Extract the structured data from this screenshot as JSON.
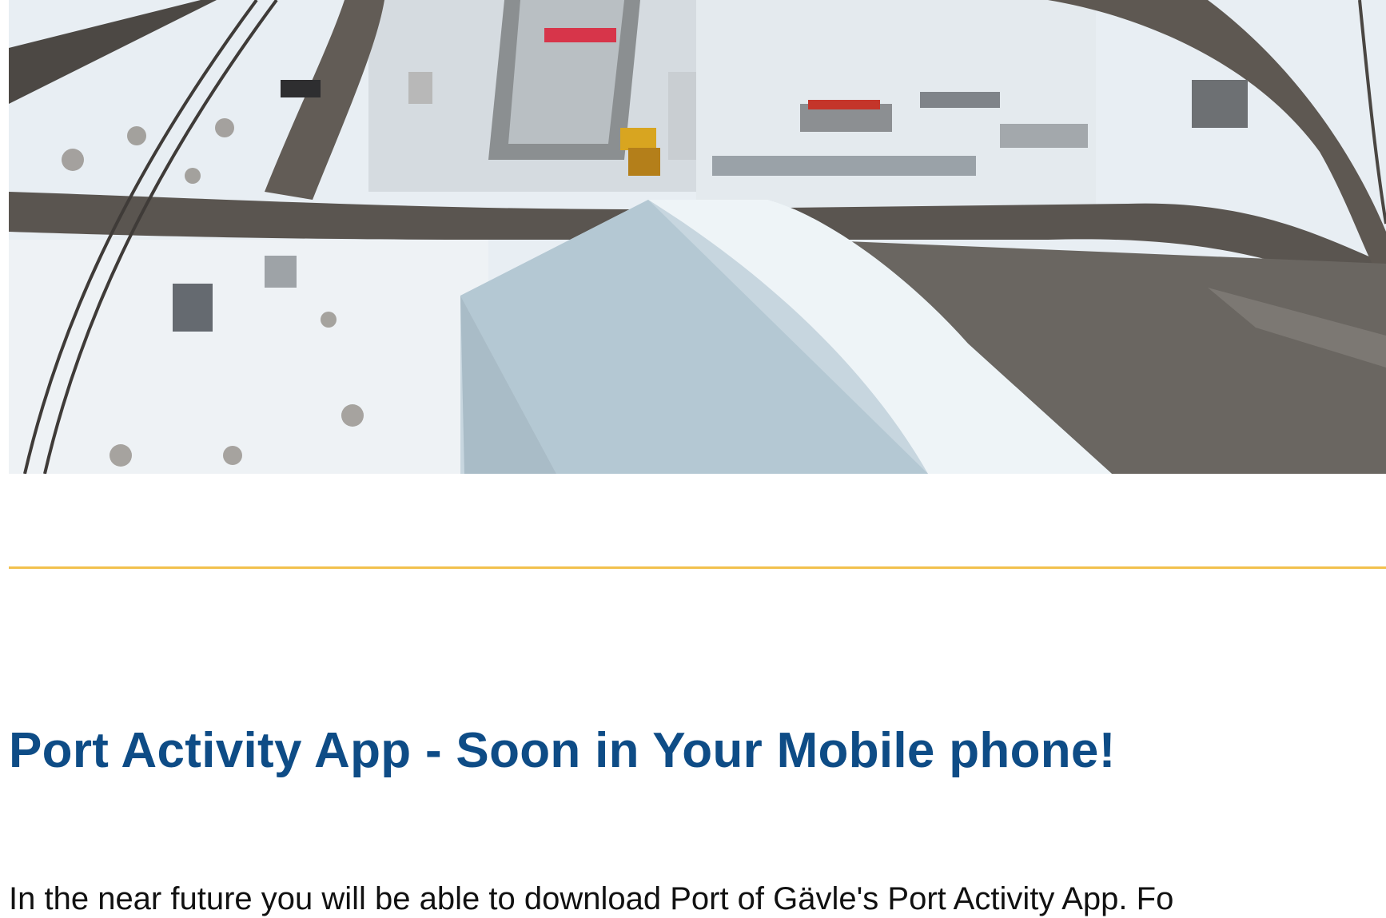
{
  "article": {
    "hero_image": {
      "subject": "aerial photo of a snowy port construction site"
    },
    "divider_color": "#f2c14e",
    "heading": "Port Activity App - Soon in Your Mobile phone!",
    "heading_color": "#0e4c86",
    "body_start": "In the near future you will be able to download Port of Gävle's Port Activity App. Fo"
  }
}
